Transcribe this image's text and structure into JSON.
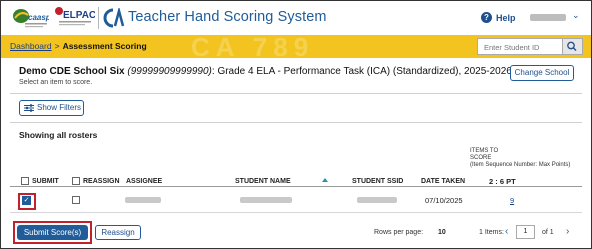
{
  "header": {
    "caaspp_logo": "CAASPP",
    "elpac_logo": "ELPAC",
    "app_title": "Teacher Hand Scoring System",
    "help_label": "Help"
  },
  "band": {
    "breadcrumb_home": "Dashboard",
    "breadcrumb_separator": ">",
    "breadcrumb_current": "Assessment Scoring",
    "search_placeholder": "Enter Student ID",
    "watermark": "CA 789"
  },
  "school": {
    "name": "Demo CDE School Six",
    "code": "(99999909999990)",
    "test": ": Grade 4 ELA - Performance Task (ICA) (Standardized), 2025-2026",
    "instruction": "Select an item to score.",
    "change_school_label": "Change School"
  },
  "filters": {
    "show_filters_label": "Show Filters"
  },
  "rosters": {
    "showing_label": "Showing all rosters"
  },
  "table": {
    "headers": {
      "submit": "SUBMIT",
      "reassign": "REASSIGN",
      "assignee": "ASSIGNEE",
      "student_name": "STUDENT NAME",
      "student_ssid": "STUDENT SSID",
      "date_taken": "DATE TAKEN",
      "items_to_score_1": "ITEMS TO",
      "items_to_score_2": "SCORE",
      "items_to_score_3": "(Item Sequence Number: Max Points)",
      "items_points": "2 : 6 PT"
    },
    "rows": [
      {
        "submit_checked": true,
        "reassign_checked": false,
        "date_taken": "07/10/2025",
        "score_link": "9"
      }
    ]
  },
  "footer": {
    "submit_label": "Submit Score(s)",
    "reassign_label": "Reassign",
    "rows_per_page_label": "Rows per page:",
    "rows_per_page_value": "10",
    "items_count": "1 Items:",
    "page_current": "1",
    "page_of": "of 1"
  },
  "colors": {
    "brand_blue": "#1f5c99",
    "band_yellow": "#f3c41f",
    "highlight_red": "#c2202a"
  }
}
